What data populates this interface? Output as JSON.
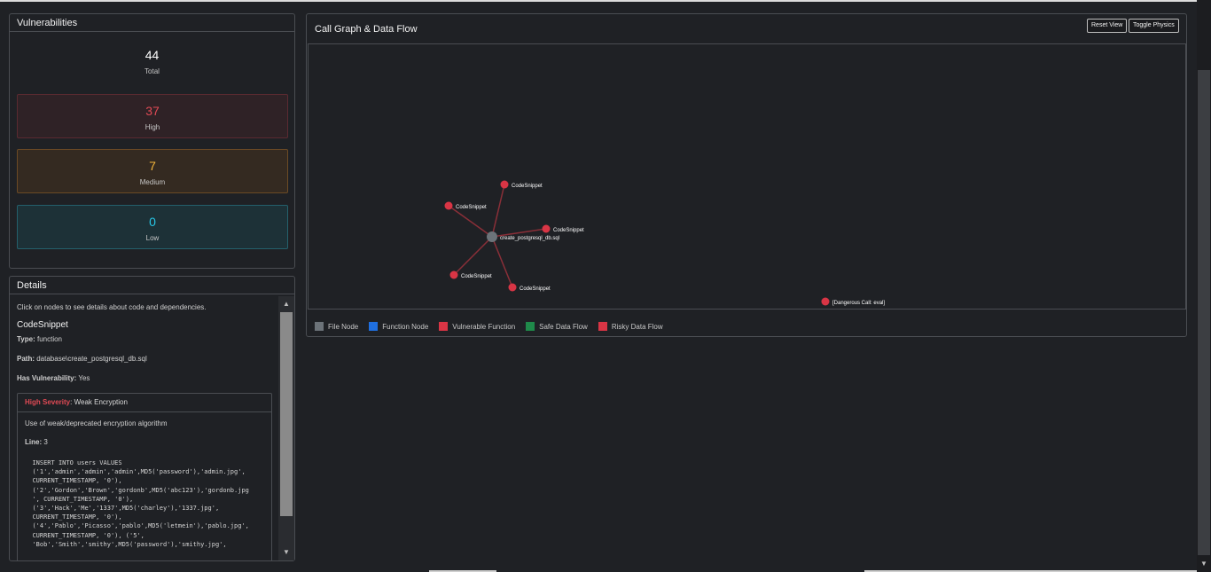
{
  "vulnerabilities": {
    "title": "Vulnerabilities",
    "total": {
      "value": "44",
      "label": "Total"
    },
    "high": {
      "value": "37",
      "label": "High"
    },
    "medium": {
      "value": "7",
      "label": "Medium"
    },
    "low": {
      "value": "0",
      "label": "Low"
    }
  },
  "details": {
    "title": "Details",
    "hint": "Click on nodes to see details about code and dependencies.",
    "node_name": "CodeSnippet",
    "type_label": "Type:",
    "type_value": "function",
    "path_label": "Path:",
    "path_value": "database\\create_postgresql_db.sql",
    "has_vuln_label": "Has Vulnerability:",
    "has_vuln_value": "Yes",
    "vuln": {
      "severity": "High Severity",
      "title": ": Weak Encryption",
      "description": "Use of weak/deprecated encryption algorithm",
      "line_label": "Line:",
      "line_value": "3",
      "code": "  INSERT INTO users VALUES\n  ('1','admin','admin','admin',MD5('password'),'admin.jpg',\n  CURRENT_TIMESTAMP, '0'),\n  ('2','Gordon','Brown','gordonb',MD5('abc123'),'gordonb.jpg\n  ', CURRENT_TIMESTAMP, '0'),\n  ('3','Hack','Me','1337',MD5('charley'),'1337.jpg',\n  CURRENT_TIMESTAMP, '0'),\n  ('4','Pablo','Picasso','pablo',MD5('letmein'),'pablo.jpg',\n  CURRENT_TIMESTAMP, '0'), ('5',\n  'Bob','Smith','smithy',MD5('password'),'smithy.jpg',"
    }
  },
  "graph": {
    "title": "Call Graph & Data Flow",
    "reset_label": "Reset View",
    "physics_label": "Toggle Physics",
    "nodes": [
      {
        "label": "create_postgresql_db.sql",
        "kind": "file"
      },
      {
        "label": "CodeSnippet",
        "kind": "vulnerable"
      },
      {
        "label": "CodeSnippet",
        "kind": "vulnerable"
      },
      {
        "label": "CodeSnippet",
        "kind": "vulnerable"
      },
      {
        "label": "CodeSnippet",
        "kind": "vulnerable"
      },
      {
        "label": "CodeSnippet",
        "kind": "vulnerable"
      },
      {
        "label": "[Dangerous Call: eval]",
        "kind": "vulnerable"
      }
    ],
    "legend": [
      {
        "label": "File Node",
        "color": "#6c7379"
      },
      {
        "label": "Function Node",
        "color": "#1f6fe0"
      },
      {
        "label": "Vulnerable Function",
        "color": "#d93545"
      },
      {
        "label": "Safe Data Flow",
        "color": "#1f8a4a"
      },
      {
        "label": "Risky Data Flow",
        "color": "#d93545"
      }
    ]
  },
  "colors": {
    "file_node": "#6c7379",
    "vulnerable_node": "#d93545",
    "edge": "#8a2f38"
  }
}
